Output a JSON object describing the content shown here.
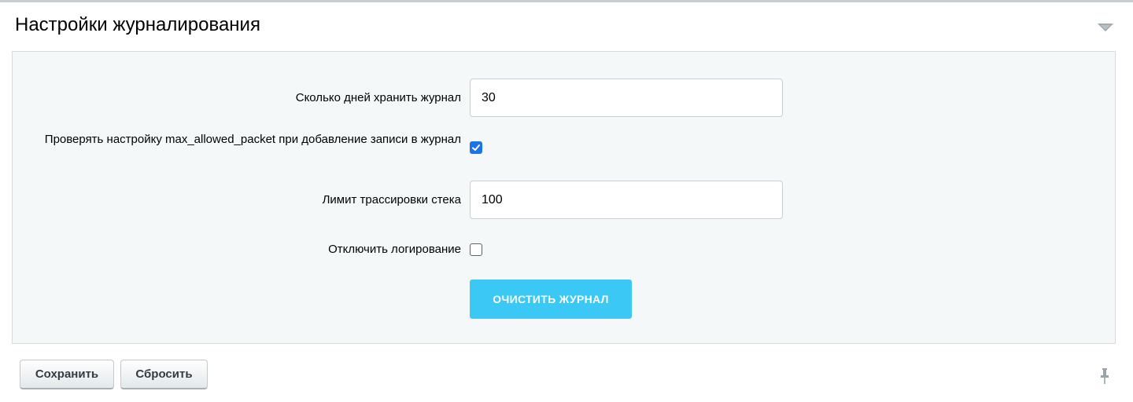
{
  "section": {
    "title": "Настройки журналирования",
    "collapse_icon": "triangle-down-icon"
  },
  "settings": {
    "retention_days": {
      "label": "Сколько дней хранить журнал",
      "value": "30"
    },
    "check_max_allowed_packet": {
      "label": "Проверять настройку max_allowed_packet при добавление записи в журнал",
      "checked": true
    },
    "stack_trace_limit": {
      "label": "Лимит трассировки стека",
      "value": "100"
    },
    "disable_logging": {
      "label": "Отключить логирование",
      "checked": false
    },
    "clear_log_label": "ОЧИСТИТЬ ЖУРНАЛ"
  },
  "footer": {
    "save_label": "Сохранить",
    "reset_label": "Сбросить",
    "pin_icon": "pin-icon"
  },
  "colors": {
    "accent_button": "#3bc8f5",
    "checkbox_checked": "#1a73e8",
    "panel_background": "#f5f8f9"
  }
}
